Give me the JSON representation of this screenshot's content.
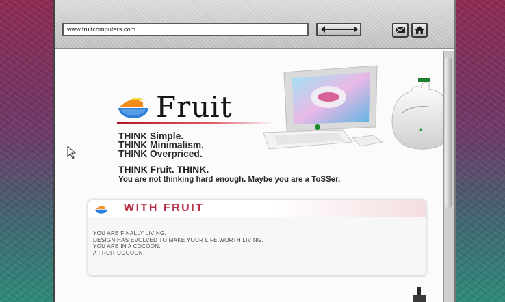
{
  "browser": {
    "url": "www.fruitcomputers.com",
    "buttons": {
      "nav": "back-forward-icon",
      "mail": "mail-icon",
      "home": "home-icon"
    }
  },
  "brand": {
    "name": "Fruit",
    "logo_icon": "fruit-bowl-icon",
    "colors": {
      "accent_red": "#b3122a",
      "title_pink": "#b8324a",
      "logo_orange": "#f28a1c",
      "logo_yellow": "#f3d23a",
      "logo_blue": "#2f7fd8"
    }
  },
  "hero": {
    "taglines": [
      "THINK Simple.",
      "THINK Minimalism.",
      "THINK Overpriced."
    ],
    "think_fruit": "THINK Fruit.  THINK.",
    "subline": "You are not thinking hard enough. Maybe you are a ToSSer."
  },
  "panel": {
    "title": "WITH FRUIT",
    "lines": [
      "YOU ARE FINALLY LIVING.",
      "DESIGN HAS EVOLVED TO MAKE YOUR LIFE WORTH LIVING.",
      "YOU ARE IN A COCOON.",
      "A FRUIT COCOON."
    ]
  }
}
